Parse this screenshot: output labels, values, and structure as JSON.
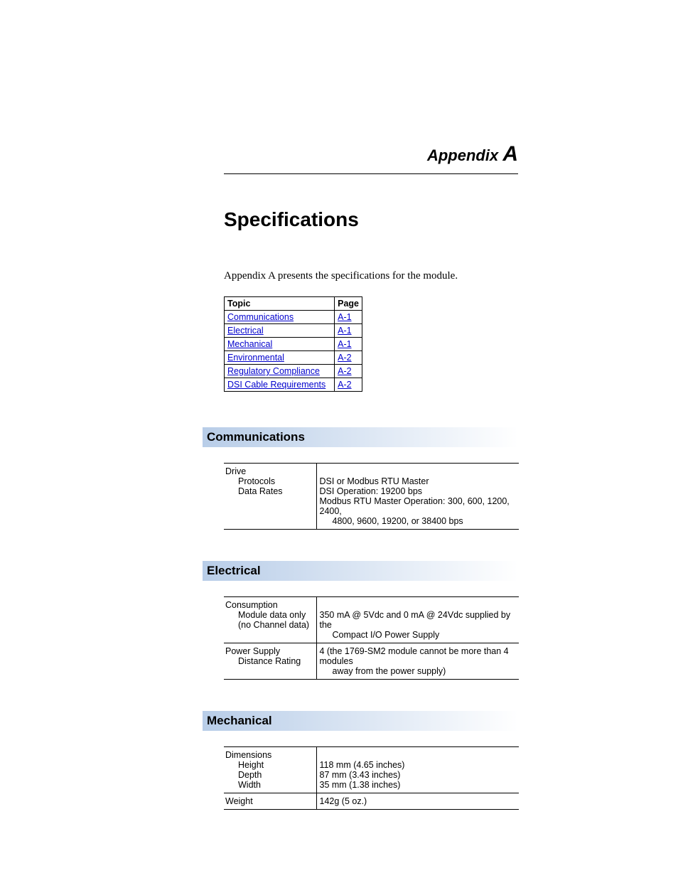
{
  "appendix_label": "Appendix",
  "appendix_letter": "A",
  "page_title": "Specifications",
  "intro_text": "Appendix A presents the specifications for the module.",
  "topic_table": {
    "headers": {
      "topic": "Topic",
      "page": "Page"
    },
    "rows": [
      {
        "topic": "Communications",
        "page": "A-1"
      },
      {
        "topic": "Electrical",
        "page": "A-1"
      },
      {
        "topic": "Mechanical",
        "page": "A-1"
      },
      {
        "topic": "Environmental",
        "page": "A-2"
      },
      {
        "topic": "Regulatory Compliance",
        "page": "A-2"
      },
      {
        "topic": "DSI Cable Requirements",
        "page": "A-2"
      }
    ]
  },
  "sections": {
    "communications": {
      "heading": "Communications",
      "label_drive": "Drive",
      "label_protocols": "Protocols",
      "label_data_rates": "Data Rates",
      "val_protocols": "DSI or Modbus RTU Master",
      "val_dsi_op": "DSI Operation: 19200 bps",
      "val_modbus_op": "Modbus RTU Master Operation: 300, 600, 1200, 2400,",
      "val_modbus_op2": "4800, 9600, 19200, or 38400 bps"
    },
    "electrical": {
      "heading": "Electrical",
      "label_consumption": "Consumption",
      "label_module_data": "Module data only",
      "label_no_channel": "(no Channel data)",
      "val_consumption": "350 mA @ 5Vdc and 0 mA @ 24Vdc supplied by the",
      "val_consumption2": "Compact I/O Power Supply",
      "label_ps_dist1": "Power Supply",
      "label_ps_dist2": "Distance Rating",
      "val_ps_dist": "4 (the 1769-SM2 module cannot be more than 4 modules",
      "val_ps_dist2": "away from the power supply)"
    },
    "mechanical": {
      "heading": "Mechanical",
      "label_dimensions": "Dimensions",
      "label_height": "Height",
      "label_depth": "Depth",
      "label_width": "Width",
      "val_height": "118 mm (4.65 inches)",
      "val_depth": "87 mm (3.43 inches)",
      "val_width": "35 mm (1.38 inches)",
      "label_weight": "Weight",
      "val_weight": "142g (5 oz.)"
    }
  }
}
